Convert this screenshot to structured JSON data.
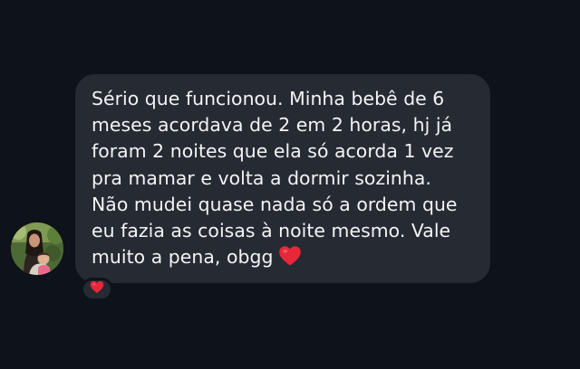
{
  "message": {
    "lines": [
      "Sério que funcionou. Minha bebê de 6",
      "meses acordava de 2 em 2 horas, hj já",
      "foram 2 noites que ela só acorda 1 vez",
      "pra mamar e volta a dormir sozinha.",
      "Não mudei quase nada só a ordem que",
      "eu fazia as coisas à noite mesmo. Vale",
      "muito a pena, obgg"
    ],
    "emoji": "heart-emoji"
  },
  "reaction": {
    "emoji": "heart-emoji"
  },
  "colors": {
    "background": "#0e121a",
    "bubble": "#262a32",
    "text": "#f3f4f6",
    "heart": "#e8283a"
  },
  "avatar": {
    "icon": "profile-photo-avatar"
  }
}
